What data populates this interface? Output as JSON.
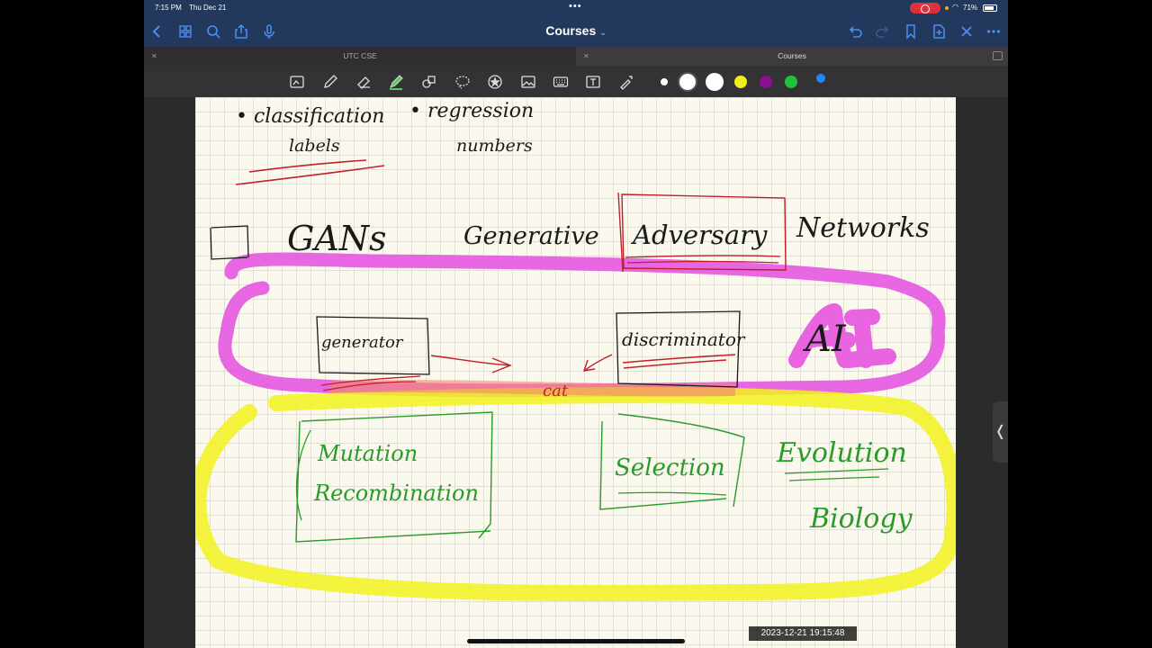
{
  "status_bar": {
    "time": "7:15 PM",
    "date": "Thu Dec 21",
    "battery": "71%"
  },
  "nav": {
    "title": "Courses"
  },
  "tabs": [
    {
      "label": "UTC CSE"
    },
    {
      "label": "Courses"
    }
  ],
  "toolbar": {
    "tools": [
      "scan-icon",
      "pen-icon",
      "eraser-icon",
      "highlighter-icon",
      "shapes-icon",
      "lasso-icon",
      "sticker-icon",
      "image-icon",
      "keyboard-icon",
      "text-box-icon",
      "laser-pointer-icon"
    ],
    "colors": [
      "#ffffff",
      "#ffffff",
      "#ffffff",
      "#f2ee1a",
      "#8a1090",
      "#22c13b",
      "#1e88f5"
    ]
  },
  "notes": {
    "line1_left": "• classification",
    "line1_right": "• regression",
    "line2_left": "labels",
    "line2_right": "numbers",
    "gans": "GANs",
    "generative": "Generative",
    "adversary": "Adversary",
    "networks": "Networks",
    "generator": "generator",
    "discriminator": "discriminator",
    "ai": "AI",
    "cat": "cat",
    "mutation": "Mutation",
    "recombination": "Recombination",
    "selection": "Selection",
    "evolution": "Evolution",
    "biology": "Biology"
  },
  "overlay": {
    "timestamp": "2023-12-21 19:15:48"
  },
  "colors": {
    "nav_bg": "#22385c",
    "accent": "#4a8ff0",
    "ink_black": "#1a1a1a",
    "ink_red": "#c0202a",
    "ink_green": "#2a9a2a",
    "highlight_magenta": "#e657e0",
    "highlight_yellow": "#f2f21f"
  }
}
